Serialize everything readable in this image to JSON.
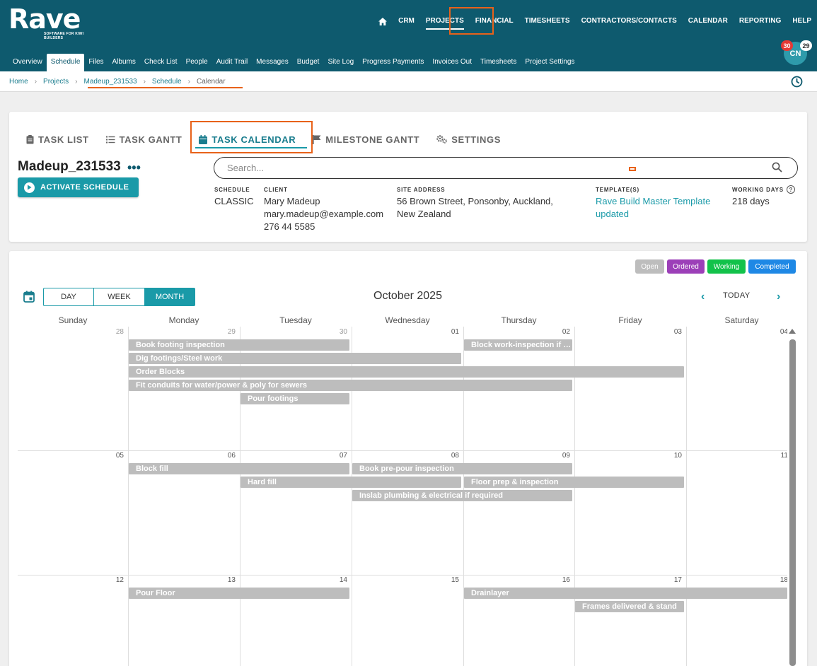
{
  "brand": {
    "name": "Rave",
    "tagline": "SOFTWARE FOR KIWI BUILDERS"
  },
  "main_nav": [
    "CRM",
    "PROJECTS",
    "FINANCIAL",
    "TIMESHEETS",
    "CONTRACTORS/CONTACTS",
    "CALENDAR",
    "REPORTING",
    "HELP"
  ],
  "sub_nav": [
    "Overview",
    "Schedule",
    "Files",
    "Albums",
    "Check List",
    "People",
    "Audit Trail",
    "Messages",
    "Budget",
    "Site Log",
    "Progress Payments",
    "Invoices Out",
    "Timesheets",
    "Project Settings"
  ],
  "user": {
    "initials": "CN",
    "badge_red": "30",
    "badge_white": "29"
  },
  "breadcrumb": [
    "Home",
    "Projects",
    "Madeup_231533",
    "Schedule",
    "Calendar"
  ],
  "tabs": [
    "TASK LIST",
    "TASK GANTT",
    "TASK CALENDAR",
    "MILESTONE GANTT",
    "SETTINGS"
  ],
  "project": {
    "title": "Madeup_231533",
    "more": "•••",
    "activate_label": "ACTIVATE SCHEDULE",
    "search_placeholder": "Search...",
    "schedule_label": "SCHEDULE",
    "schedule_value": "CLASSIC",
    "client_label": "CLIENT",
    "client_name": "Mary Madeup",
    "client_email": "mary.madeup@example.com",
    "client_phone": "276 44 5585",
    "site_label": "SITE ADDRESS",
    "site_line1": "56 Brown Street, Ponsonby, Auckland,",
    "site_line2": "New Zealand",
    "template_label": "TEMPLATE(S)",
    "template_line1": "Rave Build Master Template",
    "template_line2": "updated",
    "working_label": "WORKING DAYS",
    "working_value": "218 days"
  },
  "legend": [
    {
      "label": "Open",
      "color": "#bdbdbd"
    },
    {
      "label": "Ordered",
      "color": "#9c3fb8"
    },
    {
      "label": "Working",
      "color": "#12c24a"
    },
    {
      "label": "Completed",
      "color": "#1e88e5"
    }
  ],
  "calendar": {
    "views": [
      "DAY",
      "WEEK",
      "MONTH"
    ],
    "active_view": "MONTH",
    "title": "October 2025",
    "today_label": "TODAY",
    "prev": "‹",
    "next": "›",
    "weekdays": [
      "Sunday",
      "Monday",
      "Tuesday",
      "Wednesday",
      "Thursday",
      "Friday",
      "Saturday"
    ],
    "weeks": [
      {
        "days": [
          "28",
          "29",
          "30",
          "01",
          "02",
          "03",
          "04"
        ],
        "other": [
          true,
          true,
          true,
          false,
          false,
          false,
          false
        ],
        "events": [
          {
            "title": "Book footing inspection",
            "start": 1,
            "span": 2,
            "lane": 0
          },
          {
            "title": "Block work-inspection if re...",
            "start": 4,
            "span": 1,
            "lane": 0
          },
          {
            "title": "Dig footings/Steel work",
            "start": 1,
            "span": 3,
            "lane": 1
          },
          {
            "title": "Order Blocks",
            "start": 1,
            "span": 5,
            "lane": 2
          },
          {
            "title": "Fit conduits for water/power & poly for sewers",
            "start": 1,
            "span": 4,
            "lane": 3
          },
          {
            "title": "Pour footings",
            "start": 2,
            "span": 1,
            "lane": 4
          }
        ]
      },
      {
        "days": [
          "05",
          "06",
          "07",
          "08",
          "09",
          "10",
          "11"
        ],
        "other": [
          false,
          false,
          false,
          false,
          false,
          false,
          false
        ],
        "events": [
          {
            "title": "Block fill",
            "start": 1,
            "span": 2,
            "lane": 0
          },
          {
            "title": "Book pre-pour inspection",
            "start": 3,
            "span": 2,
            "lane": 0
          },
          {
            "title": "Hard fill",
            "start": 2,
            "span": 2,
            "lane": 1
          },
          {
            "title": "Floor prep & inspection",
            "start": 4,
            "span": 2,
            "lane": 1
          },
          {
            "title": "Inslab plumbing & electrical if required",
            "start": 3,
            "span": 2,
            "lane": 2
          }
        ]
      },
      {
        "days": [
          "12",
          "13",
          "14",
          "15",
          "16",
          "17",
          "18"
        ],
        "other": [
          false,
          false,
          false,
          false,
          false,
          false,
          false
        ],
        "events": [
          {
            "title": "Pour Floor",
            "start": 1,
            "span": 2,
            "lane": 0
          },
          {
            "title": "Drainlayer",
            "start": 4,
            "span": 3,
            "lane": 0
          },
          {
            "title": "Frames delivered & stand",
            "start": 5,
            "span": 1,
            "lane": 1
          }
        ]
      }
    ]
  }
}
